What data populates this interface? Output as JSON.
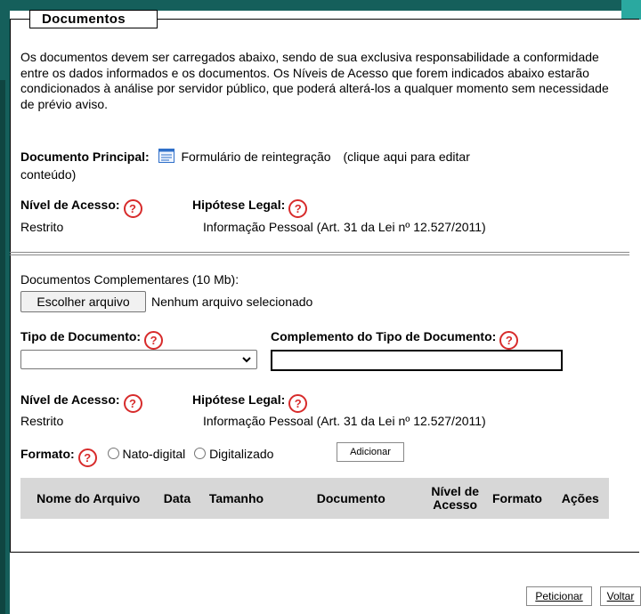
{
  "fieldset": {
    "legend": "Documentos"
  },
  "intro": "Os documentos devem ser carregados abaixo, sendo de sua exclusiva responsabilidade a conformidade entre os dados informados e os documentos. Os Níveis de Acesso que forem indicados abaixo estarão condicionados à análise por servidor público, que poderá alterá-los a qualquer momento sem necessidade de prévio aviso.",
  "principal": {
    "label": "Documento Principal:",
    "icon": "form-icon",
    "doc_name": "Formulário de reintegração",
    "edit_hint": "(clique aqui para editar",
    "edit_hint_cont": "conteúdo)",
    "nivel_label": "Nível de Acesso:",
    "nivel_value": "Restrito",
    "hipotese_label": "Hipótese Legal:",
    "hipotese_value": "Informação Pessoal (Art. 31 da Lei nº 12.527/2011)"
  },
  "complementares": {
    "label": "Documentos Complementares (10 Mb):",
    "file_button": "Escolher arquivo",
    "file_status": "Nenhum arquivo selecionado",
    "tipo_label": "Tipo de Documento:",
    "tipo_value": "",
    "complemento_label": "Complemento do Tipo de Documento:",
    "complemento_value": "",
    "nivel_label": "Nível de Acesso:",
    "nivel_value": "Restrito",
    "hipotese_label": "Hipótese Legal:",
    "hipotese_value": "Informação Pessoal (Art. 31 da Lei nº 12.527/2011)",
    "formato_label": "Formato:",
    "formato_options": [
      "Nato-digital",
      "Digitalizado"
    ],
    "add_button": "Adicionar"
  },
  "table": {
    "headers": [
      "Nome do Arquivo",
      "Data",
      "Tamanho",
      "Documento",
      "Nível de",
      "Acesso",
      "Formato",
      "Ações"
    ]
  },
  "footer": {
    "peticionar": "Peticionar",
    "voltar": "Voltar"
  },
  "help_glyph": "?",
  "colors": {
    "frame": "#155f5b",
    "help": "#d72b2b",
    "table_header": "#d7d7d7"
  }
}
